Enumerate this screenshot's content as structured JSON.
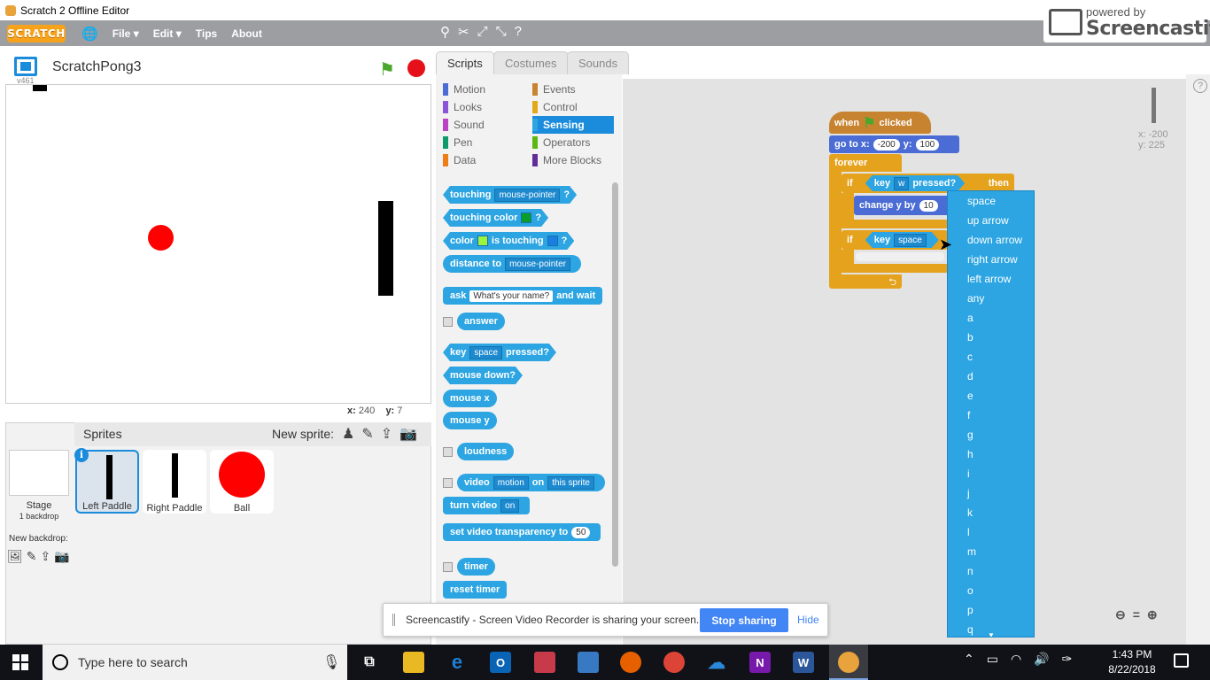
{
  "window": {
    "title": "Scratch 2 Offline Editor"
  },
  "menubar": {
    "logo": "SCRATCH",
    "items": [
      "File ▾",
      "Edit ▾",
      "Tips",
      "About"
    ]
  },
  "watermark": {
    "powered_by": "powered by",
    "name": "Screencastify"
  },
  "stage": {
    "project_name": "ScratchPong3",
    "version": "v461",
    "mouse_x_label": "x:",
    "mouse_x": "240",
    "mouse_y_label": "y:",
    "mouse_y": "7"
  },
  "sprites_pane": {
    "title": "Sprites",
    "new_sprite_label": "New sprite:",
    "stage_label": "Stage",
    "stage_backdrops": "1 backdrop",
    "new_backdrop_label": "New backdrop:",
    "sprites": [
      {
        "name": "Left Paddle",
        "selected": true
      },
      {
        "name": "Right Paddle",
        "selected": false
      },
      {
        "name": "Ball",
        "selected": false
      }
    ]
  },
  "tabs": [
    "Scripts",
    "Costumes",
    "Sounds"
  ],
  "categories": {
    "left": [
      {
        "label": "Motion",
        "color": "#4a6cd4"
      },
      {
        "label": "Looks",
        "color": "#8a55d7"
      },
      {
        "label": "Sound",
        "color": "#bb42c3"
      },
      {
        "label": "Pen",
        "color": "#0e9a6c"
      },
      {
        "label": "Data",
        "color": "#ee7d16"
      }
    ],
    "right": [
      {
        "label": "Events",
        "color": "#c88330"
      },
      {
        "label": "Control",
        "color": "#e1a91a"
      },
      {
        "label": "Sensing",
        "color": "#2ca5e2"
      },
      {
        "label": "Operators",
        "color": "#5cb712"
      },
      {
        "label": "More Blocks",
        "color": "#632d99"
      }
    ]
  },
  "palette_blocks": {
    "touching": "touching",
    "touching_opt": "mouse-pointer",
    "q": "?",
    "touching_color": "touching color",
    "color": "color",
    "is_touching": "is touching",
    "distance_to": "distance to",
    "distance_opt": "mouse-pointer",
    "ask": "ask",
    "ask_text": "What's your name?",
    "and_wait": "and wait",
    "answer": "answer",
    "key": "key",
    "key_opt": "space",
    "pressed": "pressed?",
    "mouse_down": "mouse down?",
    "mouse_x": "mouse x",
    "mouse_y": "mouse y",
    "loudness": "loudness",
    "video": "video",
    "video_opt": "motion",
    "on": "on",
    "video_target": "this sprite",
    "turn_video": "turn video",
    "turn_video_opt": "on",
    "set_transparency": "set video transparency to",
    "transparency_val": "50",
    "timer": "timer",
    "reset_timer": "reset timer"
  },
  "script": {
    "when": "when",
    "clicked": "clicked",
    "go_to_x": "go to x:",
    "x_val": "-200",
    "y_label": "y:",
    "y_val": "100",
    "forever": "forever",
    "if": "if",
    "key": "key",
    "key1": "w",
    "pressed": "pressed?",
    "then": "then",
    "change_y_by": "change y by",
    "change_val": "10",
    "if2": "if",
    "key2_label": "key",
    "key2": "space",
    "sprite_x": "x: -200",
    "sprite_y": "y: 225"
  },
  "key_dropdown": [
    "space",
    "up arrow",
    "down arrow",
    "right arrow",
    "left arrow",
    "any",
    "a",
    "b",
    "c",
    "d",
    "e",
    "f",
    "g",
    "h",
    "i",
    "j",
    "k",
    "l",
    "m",
    "n",
    "o",
    "p",
    "q"
  ],
  "share_bar": {
    "message": "Screencastify - Screen Video Recorder is sharing your screen.",
    "stop_button": "Stop sharing",
    "hide_button": "Hide"
  },
  "taskbar": {
    "search_placeholder": "Type here to search",
    "time": "1:43 PM",
    "date": "8/22/2018"
  }
}
